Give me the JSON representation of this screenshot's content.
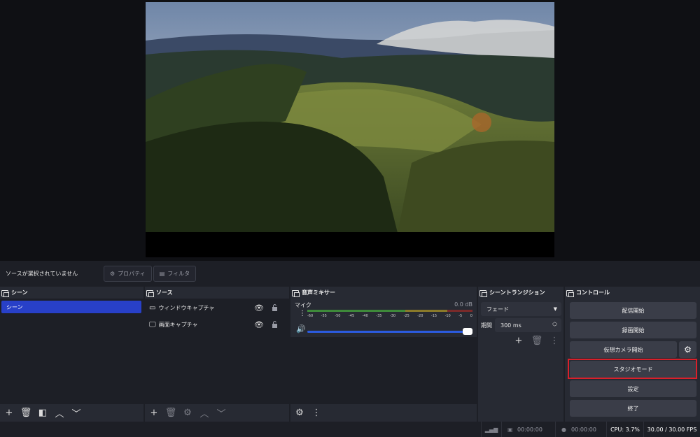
{
  "source_toolbar": {
    "no_source": "ソースが選択されていません",
    "properties_label": "プロパティ",
    "filters_label": "フィルタ"
  },
  "scenes": {
    "title": "シーン",
    "items": [
      "シーン"
    ]
  },
  "sources": {
    "title": "ソース",
    "items": [
      {
        "name": "ウィンドウキャプチャ",
        "icon": "window-icon"
      },
      {
        "name": "画面キャプチャ",
        "icon": "monitor-icon"
      }
    ]
  },
  "mixer": {
    "title": "音声ミキサー",
    "channel": "マイク",
    "db": "0.0 dB",
    "ticks": [
      "-60",
      "-55",
      "-50",
      "-45",
      "-40",
      "-35",
      "-30",
      "-25",
      "-20",
      "-15",
      "-10",
      "-5",
      "0"
    ],
    "volume": 1.0
  },
  "transitions": {
    "title": "シーントランジション",
    "type": "フェード",
    "duration_label": "期間",
    "duration": "300 ms"
  },
  "controls": {
    "title": "コントロール",
    "stream": "配信開始",
    "record": "録画開始",
    "virtual_cam": "仮想カメラ開始",
    "studio": "スタジオモード",
    "settings": "設定",
    "exit": "終了"
  },
  "status": {
    "rec_time": "00:00:00",
    "stream_time": "00:00:00",
    "cpu": "CPU: 3.7%",
    "fps": "30.00 / 30.00 FPS"
  },
  "colors": {
    "accent": "#2840c8",
    "highlight": "#d9202a"
  }
}
